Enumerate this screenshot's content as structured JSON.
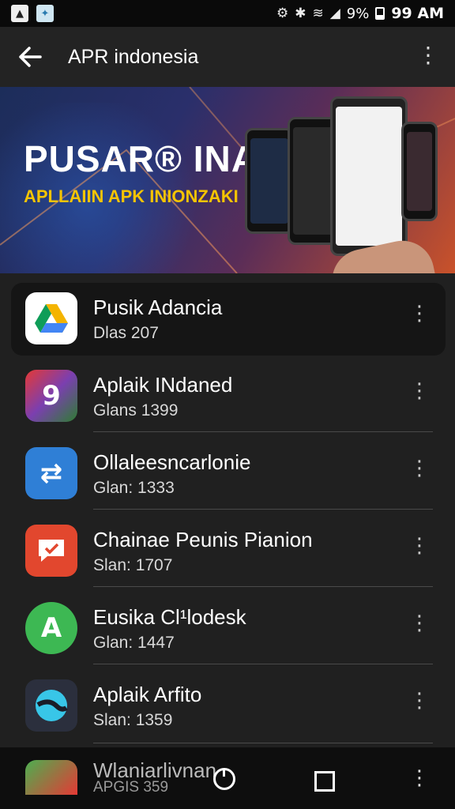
{
  "status_bar": {
    "battery": "9%",
    "time": "99 AM",
    "icons": [
      "gallery-notification-icon",
      "app-notification-icon",
      "settings-icon",
      "bluetooth-icon",
      "wifi-icon",
      "signal-icon",
      "battery-icon"
    ]
  },
  "app_bar": {
    "title": "APR indonesia"
  },
  "banner": {
    "title": "PUSAR® INAPA",
    "subtitle": "APLLAIIN APK INIONZAKI"
  },
  "apps": [
    {
      "name": "Pusik Adancia",
      "sub": "Dlas  207",
      "icon": "drive-icon",
      "color": "#ffffff"
    },
    {
      "name": "Aplaik INdaned",
      "sub": "Glans 1399",
      "icon": "nine-icon",
      "color": "#7b3fb0"
    },
    {
      "name": "Ollaleesncarlonie",
      "sub": "Glan: 1333",
      "icon": "arrows-icon",
      "color": "#2f7fd6"
    },
    {
      "name": "Chainae Peunis Pianion",
      "sub": "Slan: 1707",
      "icon": "message-check-icon",
      "color": "#e2472e"
    },
    {
      "name": "Eusika Cl¹lodesk",
      "sub": "Glan: 1447",
      "icon": "a-letter-icon",
      "color": "#3db853"
    },
    {
      "name": "Aplaik Arfito",
      "sub": "Slan: 1359",
      "icon": "swirl-icon",
      "color": "#2b2f3d"
    }
  ],
  "peek_item": {
    "name": "Wlaniarlivnan",
    "sub": "APGIS 359"
  }
}
